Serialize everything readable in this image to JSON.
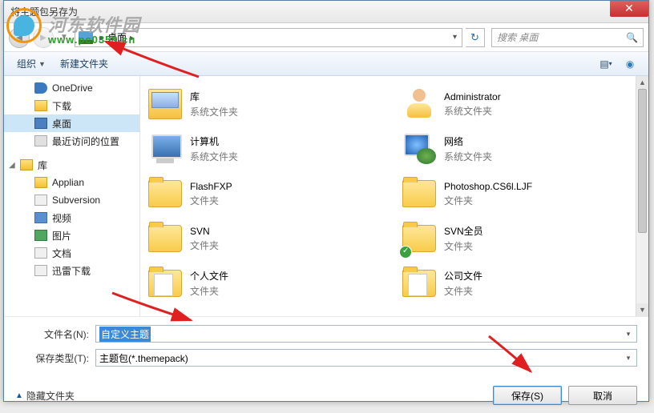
{
  "title": "将主题包另存为",
  "nav": {
    "breadcrumb_item": "桌面",
    "search_placeholder": "搜索 桌面"
  },
  "toolbar": {
    "organize": "组织",
    "new_folder": "新建文件夹"
  },
  "sidebar": {
    "favorites": [
      {
        "label": "OneDrive",
        "iconCls": "ic-cloud"
      },
      {
        "label": "下载",
        "iconCls": "ic-dl"
      },
      {
        "label": "桌面",
        "iconCls": "ic-desktop",
        "selected": true
      },
      {
        "label": "最近访问的位置",
        "iconCls": "ic-recent"
      }
    ],
    "libraries_label": "库",
    "libraries": [
      {
        "label": "Applian",
        "iconCls": "ic-lib"
      },
      {
        "label": "Subversion",
        "iconCls": "ic-doc"
      },
      {
        "label": "视频",
        "iconCls": "ic-vid"
      },
      {
        "label": "图片",
        "iconCls": "ic-pic"
      },
      {
        "label": "文档",
        "iconCls": "ic-doc"
      },
      {
        "label": "迅雷下载",
        "iconCls": "ic-doc"
      }
    ]
  },
  "files": [
    {
      "name": "库",
      "type": "系统文件夹",
      "iconKind": "lib"
    },
    {
      "name": "Administrator",
      "type": "系统文件夹",
      "iconKind": "user"
    },
    {
      "name": "计算机",
      "type": "系统文件夹",
      "iconKind": "comp"
    },
    {
      "name": "网络",
      "type": "系统文件夹",
      "iconKind": "net"
    },
    {
      "name": "FlashFXP",
      "type": "文件夹",
      "iconKind": "folder"
    },
    {
      "name": "Photoshop.CS6l.LJF",
      "type": "文件夹",
      "iconKind": "folder"
    },
    {
      "name": "SVN",
      "type": "文件夹",
      "iconKind": "folder"
    },
    {
      "name": "SVN全员",
      "type": "文件夹",
      "iconKind": "folder",
      "check": true
    },
    {
      "name": "个人文件",
      "type": "文件夹",
      "iconKind": "folder-paper"
    },
    {
      "name": "公司文件",
      "type": "文件夹",
      "iconKind": "folder-paper"
    }
  ],
  "fields": {
    "filename_label": "文件名(N):",
    "filename_value": "自定义主题",
    "filetype_label": "保存类型(T):",
    "filetype_value": "主题包(*.themepack)"
  },
  "footer": {
    "hide_folders": "隐藏文件夹",
    "save": "保存(S)",
    "cancel": "取消"
  },
  "watermark": {
    "text1": "河东软件园",
    "text2": "www.pc0359.cn"
  }
}
